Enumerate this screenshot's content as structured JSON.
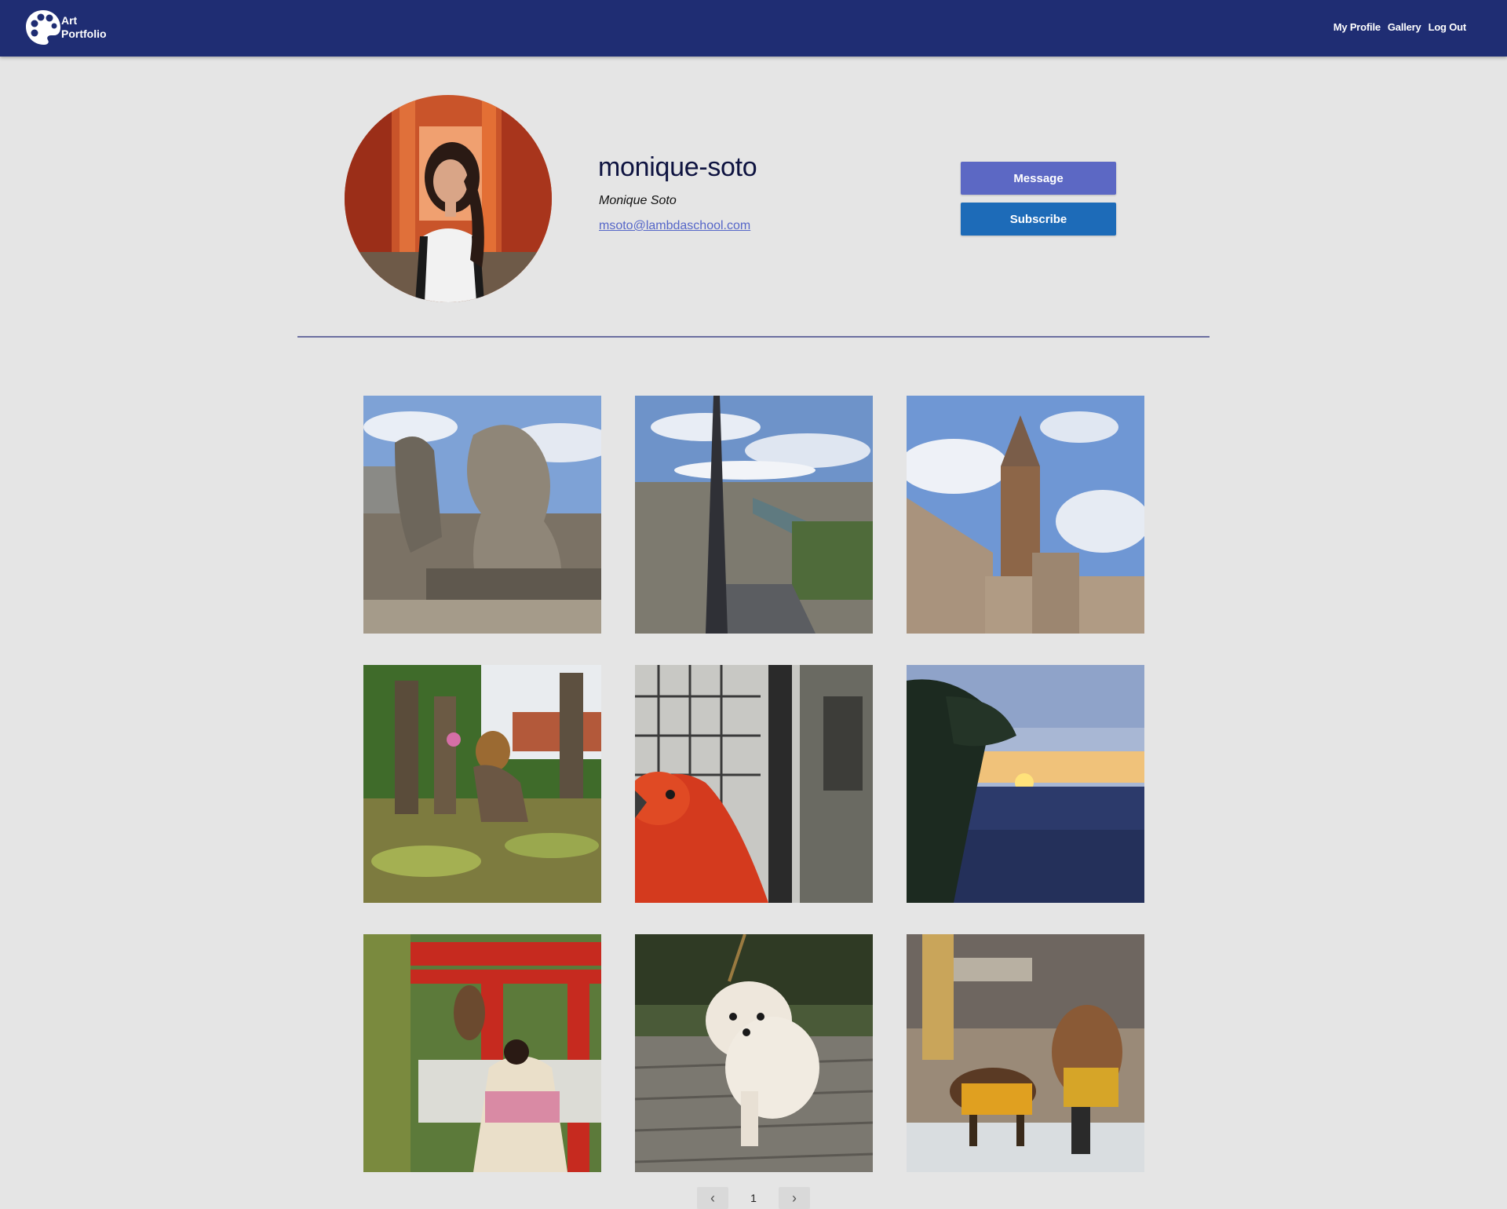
{
  "header": {
    "brand_line1": "Art",
    "brand_line2": "Portfolio",
    "nav": [
      "My Profile",
      "Gallery",
      "Log Out"
    ],
    "background": "#1f2d73"
  },
  "profile": {
    "username": "monique-soto",
    "full_name": "Monique Soto",
    "email": "msoto@lambdaschool.com",
    "message_label": "Message",
    "subscribe_label": "Subscribe",
    "message_color": "#5c68c4",
    "subscribe_color": "#1d6bb8"
  },
  "gallery": {
    "images": [
      {
        "subject": "gargoyles overlooking city"
      },
      {
        "subject": "cathedral spire and river view"
      },
      {
        "subject": "church bell tower"
      },
      {
        "subject": "statues in lily pond"
      },
      {
        "subject": "red macaw"
      },
      {
        "subject": "canyon sunset with tree"
      },
      {
        "subject": "torii gate and kimono"
      },
      {
        "subject": "white pomeranian dog"
      },
      {
        "subject": "samurai horse figurines"
      }
    ]
  },
  "pagination": {
    "prev_icon": "chevron-left-icon",
    "current_page": "1",
    "next_icon": "chevron-right-icon"
  }
}
